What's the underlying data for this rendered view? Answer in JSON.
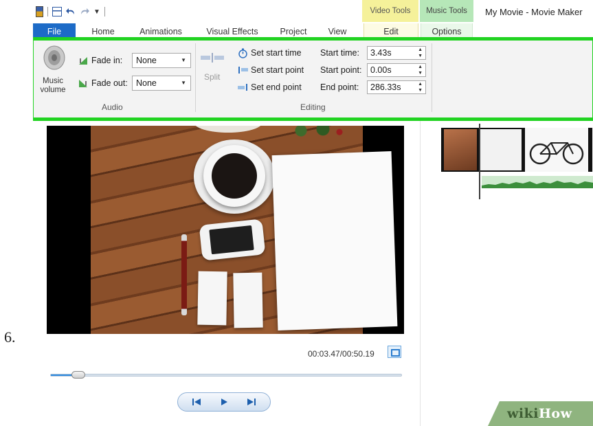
{
  "step_number": "6.",
  "window": {
    "title": "My Movie - Movie Maker"
  },
  "contextual_groups": {
    "video_tools": "Video Tools",
    "music_tools": "Music Tools"
  },
  "tabs": {
    "file": "File",
    "home": "Home",
    "animations": "Animations",
    "visual_effects": "Visual Effects",
    "project": "Project",
    "view": "View",
    "edit": "Edit",
    "options": "Options"
  },
  "ribbon": {
    "audio": {
      "music_volume_label": "Music volume",
      "fade_in_label": "Fade in:",
      "fade_in_value": "None",
      "fade_out_label": "Fade out:",
      "fade_out_value": "None",
      "group_label": "Audio"
    },
    "editing": {
      "split_label": "Split",
      "set_start_time": "Set start time",
      "set_start_point": "Set start point",
      "set_end_point": "Set end point",
      "start_time_label": "Start time:",
      "start_time_value": "3.43s",
      "start_point_label": "Start point:",
      "start_point_value": "0.00s",
      "end_point_label": "End point:",
      "end_point_value": "286.33s",
      "group_label": "Editing"
    }
  },
  "preview": {
    "timecode": "00:03.47/00:50.19",
    "seek_progress": 0.08
  },
  "watermark": {
    "wiki": "wiki",
    "how": "How"
  },
  "colors": {
    "highlight": "#21d321",
    "file_tab": "#1d6bc7",
    "video_tools": "#f5f19a",
    "music_tools": "#b6e7b8"
  }
}
